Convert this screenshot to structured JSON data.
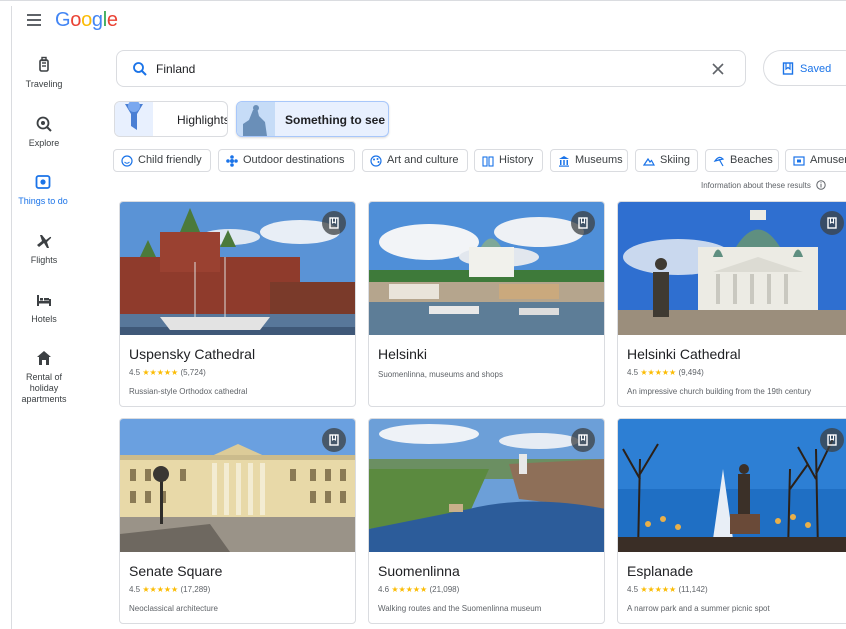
{
  "header": {
    "logo": "Google"
  },
  "sidebar": {
    "items": [
      {
        "label": "Traveling",
        "icon": "luggage-icon"
      },
      {
        "label": "Explore",
        "icon": "explore-icon"
      },
      {
        "label": "Things to do",
        "icon": "camera-icon",
        "active": true
      },
      {
        "label": "Flights",
        "icon": "plane-icon"
      },
      {
        "label": "Hotels",
        "icon": "bed-icon"
      },
      {
        "label": "Rental of holiday apartments",
        "icon": "house-icon"
      }
    ]
  },
  "search": {
    "value": "Finland"
  },
  "saved_button": {
    "label": "Saved"
  },
  "tabs": [
    {
      "label": "Highlights",
      "selected": false
    },
    {
      "label": "Something to see",
      "selected": true
    }
  ],
  "filters": [
    {
      "label": "Child friendly",
      "icon": "smiley-icon"
    },
    {
      "label": "Outdoor destinations",
      "icon": "flower-icon"
    },
    {
      "label": "Art and culture",
      "icon": "palette-icon"
    },
    {
      "label": "History",
      "icon": "history-icon"
    },
    {
      "label": "Museums",
      "icon": "museum-icon"
    },
    {
      "label": "Skiing",
      "icon": "mountain-icon"
    },
    {
      "label": "Beaches",
      "icon": "beach-icon"
    },
    {
      "label": "Amuser",
      "icon": "ticket-icon"
    }
  ],
  "info_text": "Information about these results",
  "cards": [
    {
      "title": "Uspensky Cathedral",
      "rating": "4.5",
      "stars": "★★★★★",
      "reviews": "(5,724)",
      "desc": "Russian-style Orthodox cathedral"
    },
    {
      "title": "Helsinki",
      "desc": "Suomenlinna, museums and shops"
    },
    {
      "title": "Helsinki Cathedral",
      "rating": "4.5",
      "stars": "★★★★★",
      "reviews": "(9,494)",
      "desc": "An impressive church building from the 19th century"
    },
    {
      "title": "Senate Square",
      "rating": "4.5",
      "stars": "★★★★★",
      "reviews": "(17,289)",
      "desc": "Neoclassical architecture"
    },
    {
      "title": "Suomenlinna",
      "rating": "4.6",
      "stars": "★★★★★",
      "reviews": "(21,098)",
      "desc": "Walking routes and the Suomenlinna museum"
    },
    {
      "title": "Esplanade",
      "rating": "4.5",
      "stars": "★★★★★",
      "reviews": "(11,142)",
      "desc": "A narrow park and a summer picnic spot"
    }
  ],
  "colors": {
    "accent": "#1a73e8",
    "star": "#fbbc04",
    "border": "#dadce0"
  }
}
